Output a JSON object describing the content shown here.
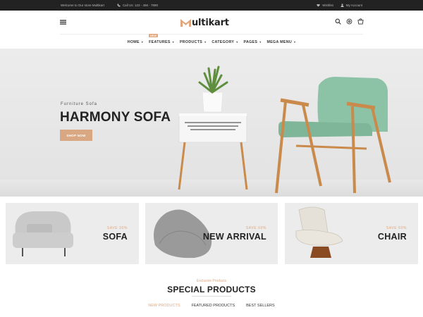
{
  "topbar": {
    "welcome": "Welcome to Our store Multikart",
    "phone": "Call Us: 123 - 456 - 7890",
    "wishlist": "Wishlist",
    "account": "My Account"
  },
  "brand": {
    "logo_text": "ultikart",
    "accent": "#e0a77f"
  },
  "header": {
    "icons": [
      "menu-icon",
      "search-icon",
      "settings-icon",
      "cart-icon"
    ]
  },
  "nav": {
    "items": [
      {
        "label": "HOME"
      },
      {
        "label": "FEATURES",
        "badge": "NEW"
      },
      {
        "label": "PRODUCTS"
      },
      {
        "label": "CATEGORY"
      },
      {
        "label": "PAGES"
      },
      {
        "label": "MEGA MENU"
      }
    ],
    "caret": "▾"
  },
  "hero": {
    "subtitle": "Furniture Sofa",
    "title": "HARMONY SOFA",
    "button": "SHOP NOW"
  },
  "banners": [
    {
      "save": "SAVE 30%",
      "name": "SOFA"
    },
    {
      "save": "SAVE 60%",
      "name": "NEW ARRIVAL"
    },
    {
      "save": "SAVE 60%",
      "name": "CHAIR"
    }
  ],
  "special": {
    "subtitle": "Exclusive Products",
    "title": "SPECIAL PRODUCTS",
    "tabs": [
      {
        "label": "NEW PRODUCTS",
        "active": true
      },
      {
        "label": "FEATURED PRODUCTS",
        "active": false
      },
      {
        "label": "BEST SELLERS",
        "active": false
      }
    ]
  }
}
